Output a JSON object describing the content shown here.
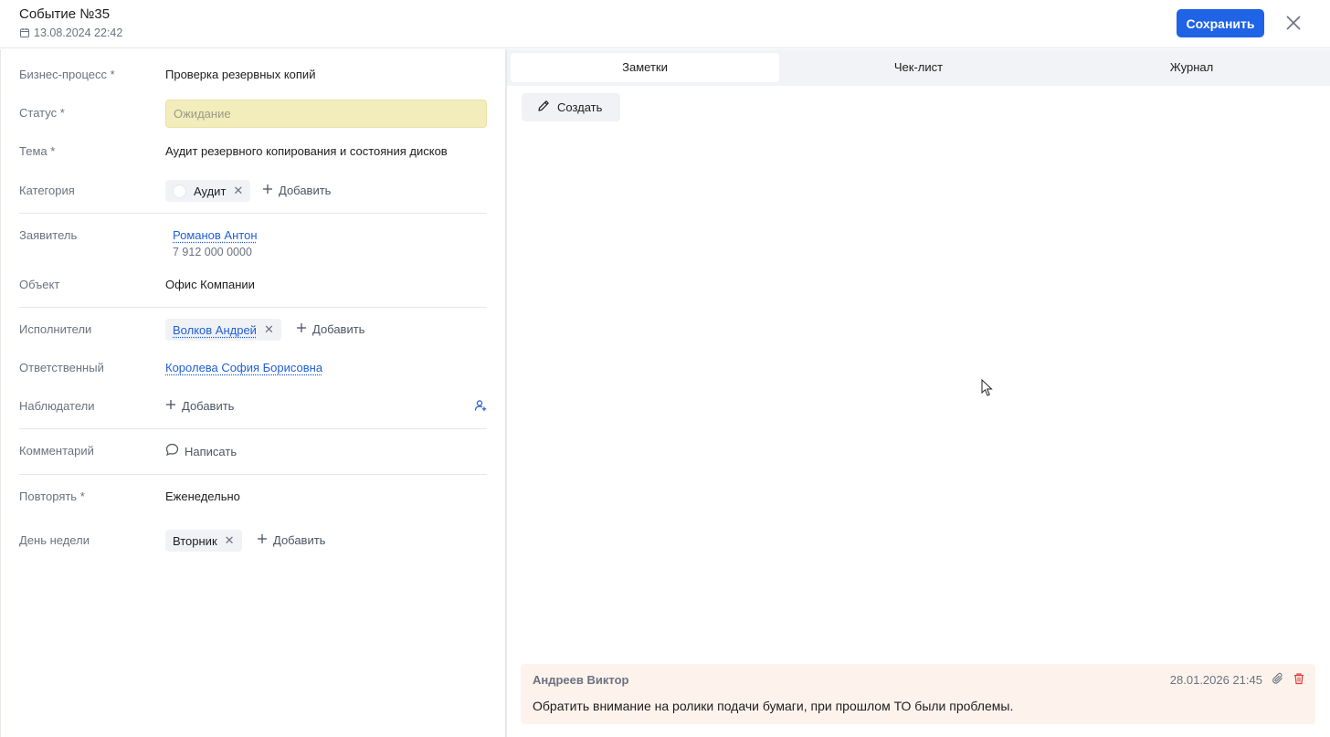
{
  "header": {
    "title": "Событие №35",
    "datetime": "13.08.2024 22:42",
    "save_label": "Сохранить"
  },
  "fields": {
    "business_process": {
      "label": "Бизнес-процесс *",
      "value": "Проверка резервных копий"
    },
    "status": {
      "label": "Статус *",
      "value": "Ожидание"
    },
    "topic": {
      "label": "Тема *",
      "value": "Аудит резервного копирования и состояния дисков"
    },
    "category": {
      "label": "Категория",
      "chip": "Аудит",
      "add_label": "Добавить"
    },
    "applicant": {
      "label": "Заявитель",
      "name": "Романов Антон",
      "phone": "7 912 000 0000"
    },
    "object": {
      "label": "Объект",
      "value": "Офис Компании"
    },
    "executors": {
      "label": "Исполнители",
      "chip": "Волков Андрей",
      "add_label": "Добавить"
    },
    "responsible": {
      "label": "Ответственный",
      "value": "Королева София Борисовна"
    },
    "observers": {
      "label": "Наблюдатели",
      "add_label": "Добавить"
    },
    "comment": {
      "label": "Комментарий",
      "action_label": "Написать"
    },
    "repeat": {
      "label": "Повторять *",
      "value": "Еженедельно"
    },
    "weekday": {
      "label": "День недели",
      "chip": "Вторник",
      "add_label": "Добавить"
    }
  },
  "tabs": [
    {
      "label": "Заметки",
      "active": true
    },
    {
      "label": "Чек-лист",
      "active": false
    },
    {
      "label": "Журнал",
      "active": false
    }
  ],
  "notes": {
    "create_label": "Создать",
    "items": [
      {
        "author": "Андреев Виктор",
        "date": "28.01.2026 21:45",
        "text": "Обратить внимание на ролики подачи бумаги, при прошлом ТО были проблемы."
      }
    ]
  },
  "colors": {
    "accent": "#1f63e6",
    "status_bg": "#f2edbb",
    "note_bg": "#fdf3ec",
    "delete": "#e03b3b"
  }
}
